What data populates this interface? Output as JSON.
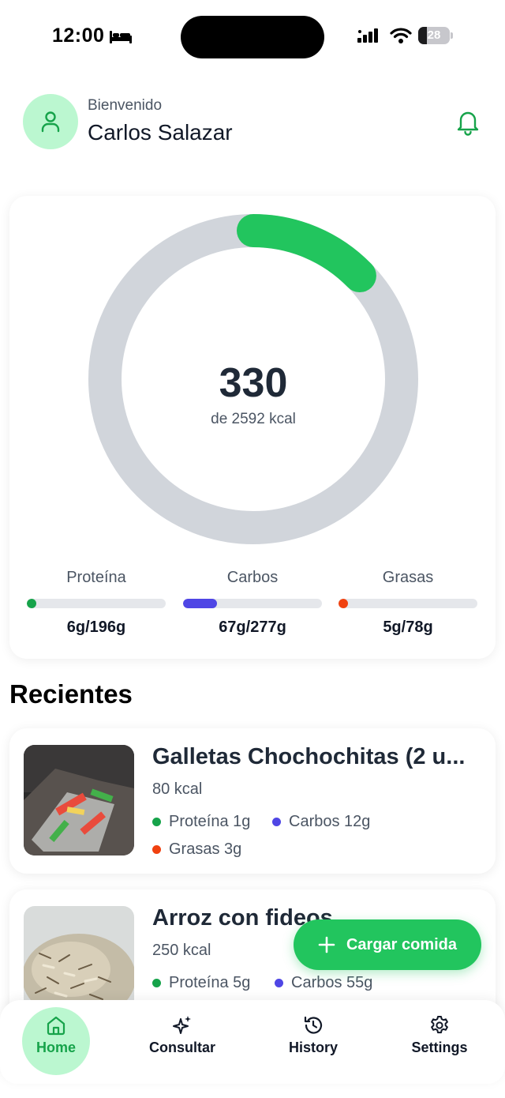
{
  "status_bar": {
    "time": "12:00",
    "battery_level": "28",
    "icons": [
      "bed-icon",
      "signal-icon",
      "wifi-icon",
      "battery-icon"
    ]
  },
  "header": {
    "greeting": "Bienvenido",
    "user_name": "Carlos Salazar",
    "icons": [
      "user-icon",
      "bell-icon"
    ]
  },
  "calories": {
    "consumed": "330",
    "goal_label": "de 2592 kcal",
    "consumed_value": 330,
    "goal_value": 2592
  },
  "macros": [
    {
      "label": "Proteína",
      "value_label": "6g/196g",
      "current": 6,
      "goal": 196,
      "color": "#16a34a"
    },
    {
      "label": "Carbos",
      "value_label": "67g/277g",
      "current": 67,
      "goal": 277,
      "color": "#4f46e5"
    },
    {
      "label": "Grasas",
      "value_label": "5g/78g",
      "current": 5,
      "goal": 78,
      "color": "#f0410f"
    }
  ],
  "recent": {
    "title": "Recientes",
    "items": [
      {
        "name": "Galletas Chochochitas (2 u...",
        "kcal": "80 kcal",
        "protein": "Proteína 1g",
        "carbs": "Carbos 12g",
        "fat": "Grasas 3g"
      },
      {
        "name": "Arroz con fideos",
        "kcal": "250 kcal",
        "protein": "Proteína 5g",
        "carbs": "Carbos 55g"
      }
    ]
  },
  "fab": {
    "label": "Cargar comida",
    "icon": "plus-icon"
  },
  "nav": {
    "items": [
      {
        "label": "Home",
        "icon": "home-icon",
        "active": true
      },
      {
        "label": "Consultar",
        "icon": "sparkles-icon",
        "active": false
      },
      {
        "label": "History",
        "icon": "history-icon",
        "active": false
      },
      {
        "label": "Settings",
        "icon": "gear-icon",
        "active": false
      }
    ]
  },
  "colors": {
    "accent": "#22c55e",
    "accent_light": "#bbf7d0",
    "protein": "#16a34a",
    "carbs": "#4f46e5",
    "fat": "#f0410f",
    "ring_track": "#d1d5db"
  }
}
